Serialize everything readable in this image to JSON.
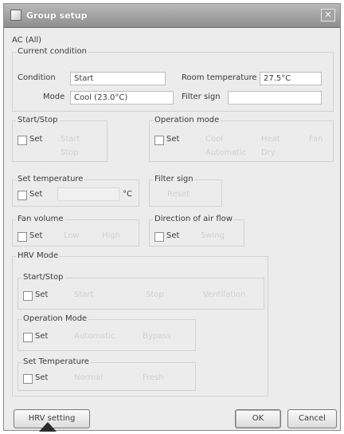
{
  "window": {
    "title": "Group setup",
    "close_glyph": "✕"
  },
  "ac_label": "AC (All)",
  "current_condition": {
    "title": "Current condition",
    "condition_label": "Condition",
    "condition_value": "Start",
    "room_temp_label": "Room temperature",
    "room_temp_value": "27.5°C",
    "mode_label": "Mode",
    "mode_value": "Cool (23.0°C)",
    "filter_sign_label": "Filter sign"
  },
  "start_stop": {
    "title": "Start/Stop",
    "set_label": "Set",
    "option1": "Start",
    "option2": "Stop"
  },
  "operation_mode": {
    "title": "Operation mode",
    "set_label": "Set",
    "opt1": "Cool",
    "opt2": "Heat",
    "opt3": "Fan",
    "opt4": "Automatic",
    "opt5": "Dry"
  },
  "set_temperature": {
    "title": "Set temperature",
    "set_label": "Set",
    "unit": "°C"
  },
  "filter_sign": {
    "title": "Filter sign",
    "reset": "Reset"
  },
  "fan_volume": {
    "title": "Fan volume",
    "set_label": "Set",
    "opt1": "Low",
    "opt2": "High"
  },
  "air_flow": {
    "title": "Direction of air flow",
    "set_label": "Set",
    "value": "Swing"
  },
  "hrv_mode": {
    "title": "HRV Mode",
    "start_stop": {
      "title": "Start/Stop",
      "set_label": "Set",
      "opt1": "Start",
      "opt2": "Stop",
      "opt3": "Ventilation"
    },
    "operation_mode": {
      "title": "Operation Mode",
      "set_label": "Set",
      "opt1": "Automatic",
      "opt2": "Bypass"
    },
    "set_temp": {
      "title": "Set Temperature",
      "set_label": "Set",
      "opt1": "Normal",
      "opt2": "Fresh"
    }
  },
  "buttons": {
    "hrv_setting": "HRV setting",
    "ok": "OK",
    "cancel": "Cancel"
  }
}
